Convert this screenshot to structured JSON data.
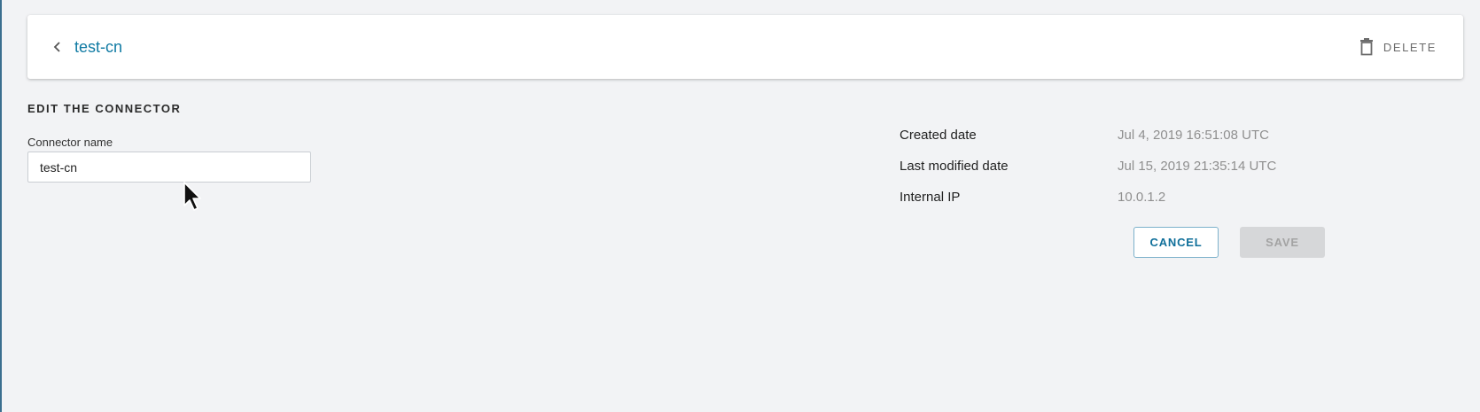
{
  "header": {
    "title": "test-cn",
    "delete_label": "DELETE",
    "back_icon": "chevron-left-icon",
    "delete_icon": "trash-icon"
  },
  "form": {
    "section_title": "EDIT THE CONNECTOR",
    "connector_name_label": "Connector name",
    "connector_name_value": "test-cn"
  },
  "details": [
    {
      "label": "Created date",
      "value": "Jul 4, 2019 16:51:08 UTC"
    },
    {
      "label": "Last modified date",
      "value": "Jul 15, 2019 21:35:14 UTC"
    },
    {
      "label": "Internal IP",
      "value": "10.0.1.2"
    }
  ],
  "actions": {
    "cancel_label": "CANCEL",
    "save_label": "SAVE"
  },
  "colors": {
    "accent": "#0f7aa3",
    "background": "#f2f3f5",
    "disabled": "#d6d7d9"
  }
}
